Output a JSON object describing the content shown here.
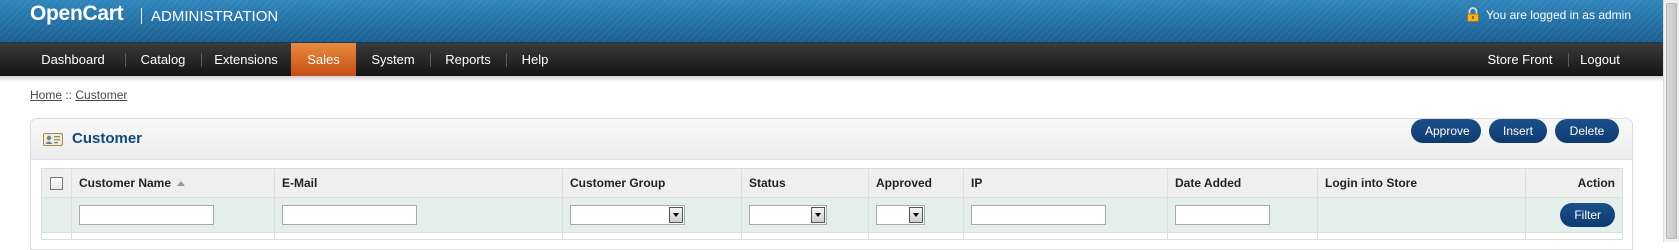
{
  "header": {
    "logo": "OpenCart",
    "title": "ADMINISTRATION",
    "login_text": "You are logged in as admin"
  },
  "menu": {
    "items": [
      {
        "label": "Dashboard",
        "active": false
      },
      {
        "label": "Catalog",
        "active": false
      },
      {
        "label": "Extensions",
        "active": false
      },
      {
        "label": "Sales",
        "active": true
      },
      {
        "label": "System",
        "active": false
      },
      {
        "label": "Reports",
        "active": false
      },
      {
        "label": "Help",
        "active": false
      }
    ],
    "right_items": [
      {
        "label": "Store Front"
      },
      {
        "label": "Logout"
      }
    ]
  },
  "breadcrumb": {
    "home": "Home",
    "separator": " :: ",
    "current": "Customer"
  },
  "panel": {
    "title": "Customer",
    "buttons": {
      "approve": "Approve",
      "insert": "Insert",
      "delete": "Delete"
    }
  },
  "table": {
    "columns": {
      "name": "Customer Name",
      "email": "E-Mail",
      "group": "Customer Group",
      "status": "Status",
      "approved": "Approved",
      "ip": "IP",
      "date_added": "Date Added",
      "login": "Login into Store",
      "action": "Action"
    },
    "filter": {
      "name_value": "",
      "email_value": "",
      "group_selected": "",
      "status_selected": "",
      "approved_selected": "",
      "ip_value": "",
      "date_added_value": "",
      "filter_button": "Filter"
    }
  },
  "colors": {
    "header_blue": "#1f6ea3",
    "menu_dark": "#222222",
    "menu_active": "#d8642a",
    "title_blue": "#11497b",
    "button_blue": "#123f76"
  }
}
